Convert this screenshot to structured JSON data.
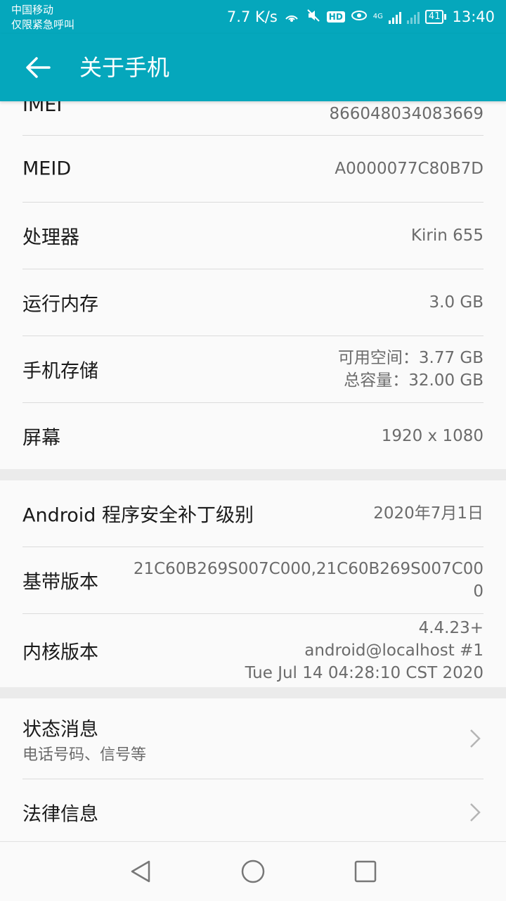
{
  "status_bar": {
    "carrier_line1": "中国移动",
    "carrier_line2": "仅限紧急呼叫",
    "speed": "7.7 K/s",
    "hd": "HD",
    "network": "4G",
    "battery": "41",
    "time": "13:40",
    "icons": [
      "hotspot-icon",
      "mute-icon",
      "hd-icon",
      "eye-icon",
      "signal-icon",
      "signal-empty-icon",
      "battery-icon"
    ]
  },
  "app_bar": {
    "title": "关于手机",
    "back_icon": "arrow-left-icon"
  },
  "items": {
    "imei": {
      "label": "IMEI",
      "value": "866048034083669"
    },
    "meid": {
      "label": "MEID",
      "value": "A0000077C80B7D"
    },
    "processor": {
      "label": "处理器",
      "value": "Kirin 655"
    },
    "ram": {
      "label": "运行内存",
      "value": "3.0 GB"
    },
    "storage": {
      "label": "手机存储",
      "available": "可用空间：3.77  GB",
      "total": "总容量：32.00  GB"
    },
    "screen": {
      "label": "屏幕",
      "value": "1920 x 1080"
    },
    "patch": {
      "label": "Android 程序安全补丁级别",
      "value": "2020年7月1日"
    },
    "baseband": {
      "label": "基带版本",
      "value_line1": "21C60B269S007C000,21C60B269S007C00",
      "value_line2": "0"
    },
    "kernel": {
      "label": "内核版本",
      "value_line1": "4.4.23+",
      "value_line2": "android@localhost #1",
      "value_line3": "Tue Jul 14 04:28:10 CST 2020"
    },
    "status": {
      "label": "状态消息",
      "sub": "电话号码、信号等"
    },
    "legal": {
      "label": "法律信息"
    }
  },
  "colors": {
    "accent": "#05a7bc",
    "background": "#fafafa",
    "divider": "#dcdcdc",
    "value_text": "#6b6b6b"
  }
}
